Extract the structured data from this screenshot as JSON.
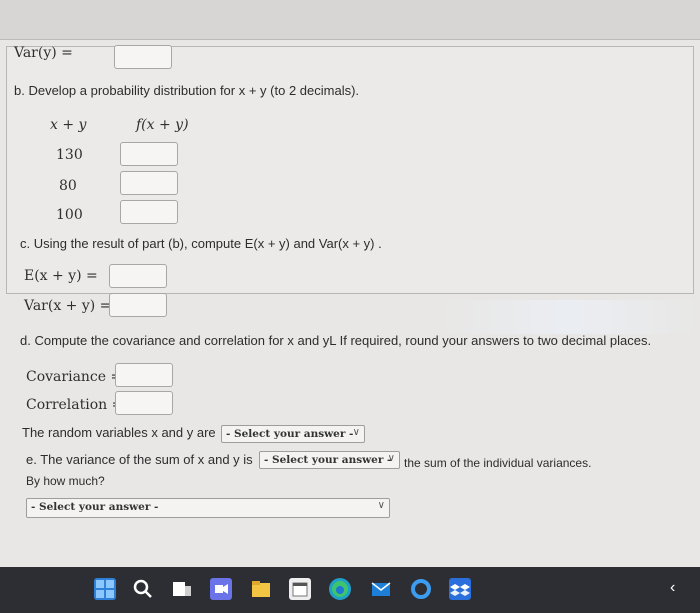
{
  "var_y": {
    "label": "Var(y) ="
  },
  "part_b": {
    "text": "b. Develop a probability distribution for x + y (to 2 decimals).",
    "col_x": "x + y",
    "col_f": "f(x + y)",
    "rows": [
      "130",
      "80",
      "100"
    ]
  },
  "part_c": {
    "text": "c. Using the result of part (b), compute E(x + y) and Var(x + y) .",
    "e_label": "E(x + y) =",
    "var_label": "Var(x + y) ="
  },
  "part_d": {
    "text": "d. Compute the covariance and correlation for x and yL If required, round your answers to two decimal places.",
    "covariance_label": "Covariance =",
    "correlation_label": "Correlation =",
    "random_text": "The random variables x and y are",
    "select1": "- Select your answer -"
  },
  "part_e": {
    "text": "e. The variance of the sum of x and y is",
    "select2": "- Select your answer -",
    "after": "the sum of the individual variances.",
    "how_much": "By how much?",
    "select3": "- Select your answer -"
  },
  "taskbar": {
    "icons": [
      "windows-icon",
      "search-icon",
      "task-view-icon",
      "chat-icon",
      "file-explorer-icon",
      "calendar-icon",
      "edge-icon",
      "mail-icon",
      "cortana-icon",
      "dropbox-icon"
    ]
  }
}
